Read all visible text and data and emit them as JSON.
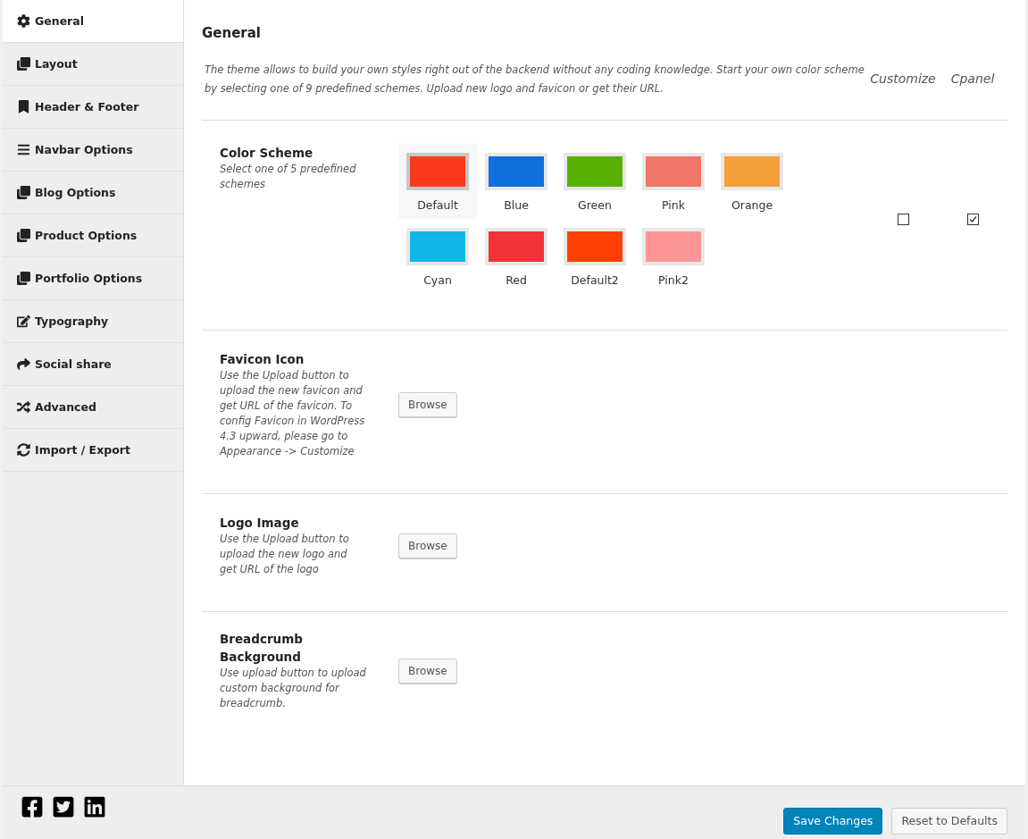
{
  "sidebar": {
    "items": [
      {
        "label": "General",
        "selected": true
      },
      {
        "label": "Layout",
        "selected": false
      },
      {
        "label": "Header & Footer",
        "selected": false
      },
      {
        "label": "Navbar Options",
        "selected": false
      },
      {
        "label": "Blog Options",
        "selected": false
      },
      {
        "label": "Product Options",
        "selected": false
      },
      {
        "label": "Portfolio Options",
        "selected": false
      },
      {
        "label": "Typography",
        "selected": false
      },
      {
        "label": "Social share",
        "selected": false
      },
      {
        "label": "Advanced",
        "selected": false
      },
      {
        "label": "Import / Export",
        "selected": false
      }
    ]
  },
  "page": {
    "title": "General",
    "description": "The theme allows to build your own styles right out of the backend without any coding knowledge. Start your own color scheme by selecting one of 9 predefined schemes. Upload new logo and favicon or get their URL.",
    "columns": [
      {
        "label": "Customize"
      },
      {
        "label": "Cpanel"
      }
    ]
  },
  "color_scheme": {
    "title": "Color Scheme",
    "hint": "Select one of 5 predefined schemes",
    "swatches": [
      {
        "label": "Default",
        "color": "#fc3a20",
        "selected": true
      },
      {
        "label": "Blue",
        "color": "#0f70dc",
        "selected": false
      },
      {
        "label": "Green",
        "color": "#5ab000",
        "selected": false
      },
      {
        "label": "Pink",
        "color": "#f07668",
        "selected": false
      },
      {
        "label": "Orange",
        "color": "#f3a038",
        "selected": false
      },
      {
        "label": "Cyan",
        "color": "#10b6e8",
        "selected": false
      },
      {
        "label": "Red",
        "color": "#f23238",
        "selected": false
      },
      {
        "label": "Default2",
        "color": "#ff3f04",
        "selected": false
      },
      {
        "label": "Pink2",
        "color": "#fc9696",
        "selected": false
      }
    ],
    "checks": [
      {
        "checked": false
      },
      {
        "checked": true
      }
    ]
  },
  "uploads": [
    {
      "title": "Favicon Icon",
      "hint": "Use the Upload button to upload the new favicon and get URL of the favicon. To config Favicon in WordPress 4.3 upward, please go to Appearance -> Customize",
      "button": "Browse"
    },
    {
      "title": "Logo Image",
      "hint": "Use the Upload button to upload the new logo and get URL of the logo",
      "button": "Browse"
    },
    {
      "title": "Breadcrumb Background",
      "hint": "Use upload button to upload custom background for breadcrumb.",
      "button": "Browse"
    }
  ],
  "footer": {
    "buttons": [
      {
        "label": "Save Changes",
        "kind": "primary"
      },
      {
        "label": "Reset to Defaults",
        "kind": "secondary"
      }
    ]
  }
}
